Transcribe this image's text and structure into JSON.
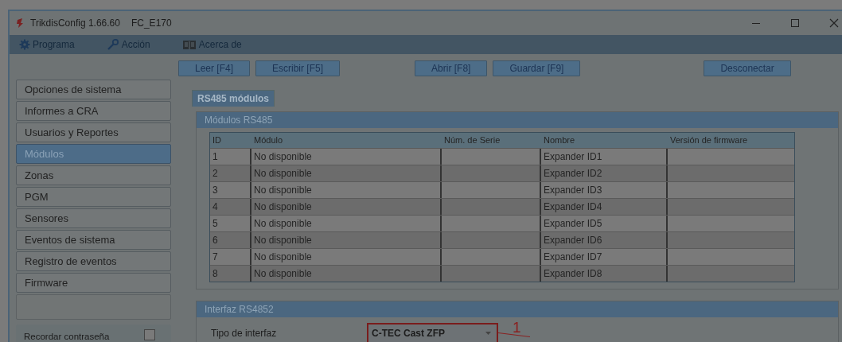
{
  "window": {
    "title": "TrikdisConfig 1.66.60",
    "device": "FC_E170"
  },
  "menu": [
    {
      "label": "Programa"
    },
    {
      "label": "Acción"
    },
    {
      "label": "Acerca de"
    }
  ],
  "toolbar": [
    [
      "Leer [F4]",
      "Escribir [F5]"
    ],
    [
      "Abrir [F8]",
      "Guardar [F9]"
    ],
    [
      "Desconectar"
    ]
  ],
  "sidebar": {
    "items": [
      {
        "label": "Opciones de sistema",
        "selected": false
      },
      {
        "label": "Informes a CRA",
        "selected": false
      },
      {
        "label": "Usuarios y Reportes",
        "selected": false
      },
      {
        "label": "Módulos",
        "selected": true
      },
      {
        "label": "Zonas",
        "selected": false
      },
      {
        "label": "PGM",
        "selected": false
      },
      {
        "label": "Sensores",
        "selected": false
      },
      {
        "label": "Eventos de sistema",
        "selected": false
      },
      {
        "label": "Registro de eventos",
        "selected": false
      },
      {
        "label": "Firmware",
        "selected": false
      }
    ],
    "remember_password": {
      "label": "Recordar contraseña",
      "checked": false
    }
  },
  "tabs": [
    {
      "label": "RS485 módulos",
      "selected": true
    }
  ],
  "modules_panel": {
    "title": "Módulos RS485",
    "table": {
      "columns": [
        "ID",
        "Módulo",
        "Núm. de Serie",
        "Nombre",
        "Versión de firmware"
      ],
      "rows": [
        [
          "1",
          "No disponible",
          null,
          "Expander ID1",
          null
        ],
        [
          "2",
          "No disponible",
          null,
          "Expander ID2",
          null
        ],
        [
          "3",
          "No disponible",
          null,
          "Expander ID3",
          null
        ],
        [
          "4",
          "No disponible",
          null,
          "Expander ID4",
          null
        ],
        [
          "5",
          "No disponible",
          null,
          "Expander ID5",
          null
        ],
        [
          "6",
          "No disponible",
          null,
          "Expander ID6",
          null
        ],
        [
          "7",
          "No disponible",
          null,
          "Expander ID7",
          null
        ],
        [
          "8",
          "No disponible",
          null,
          "Expander ID8",
          null
        ]
      ]
    }
  },
  "interface_panel": {
    "title": "Interfaz RS4852",
    "field": {
      "label": "Tipo de interfaz",
      "value": "C-TEC Cast ZFP"
    },
    "annotation": {
      "label": "1"
    }
  }
}
